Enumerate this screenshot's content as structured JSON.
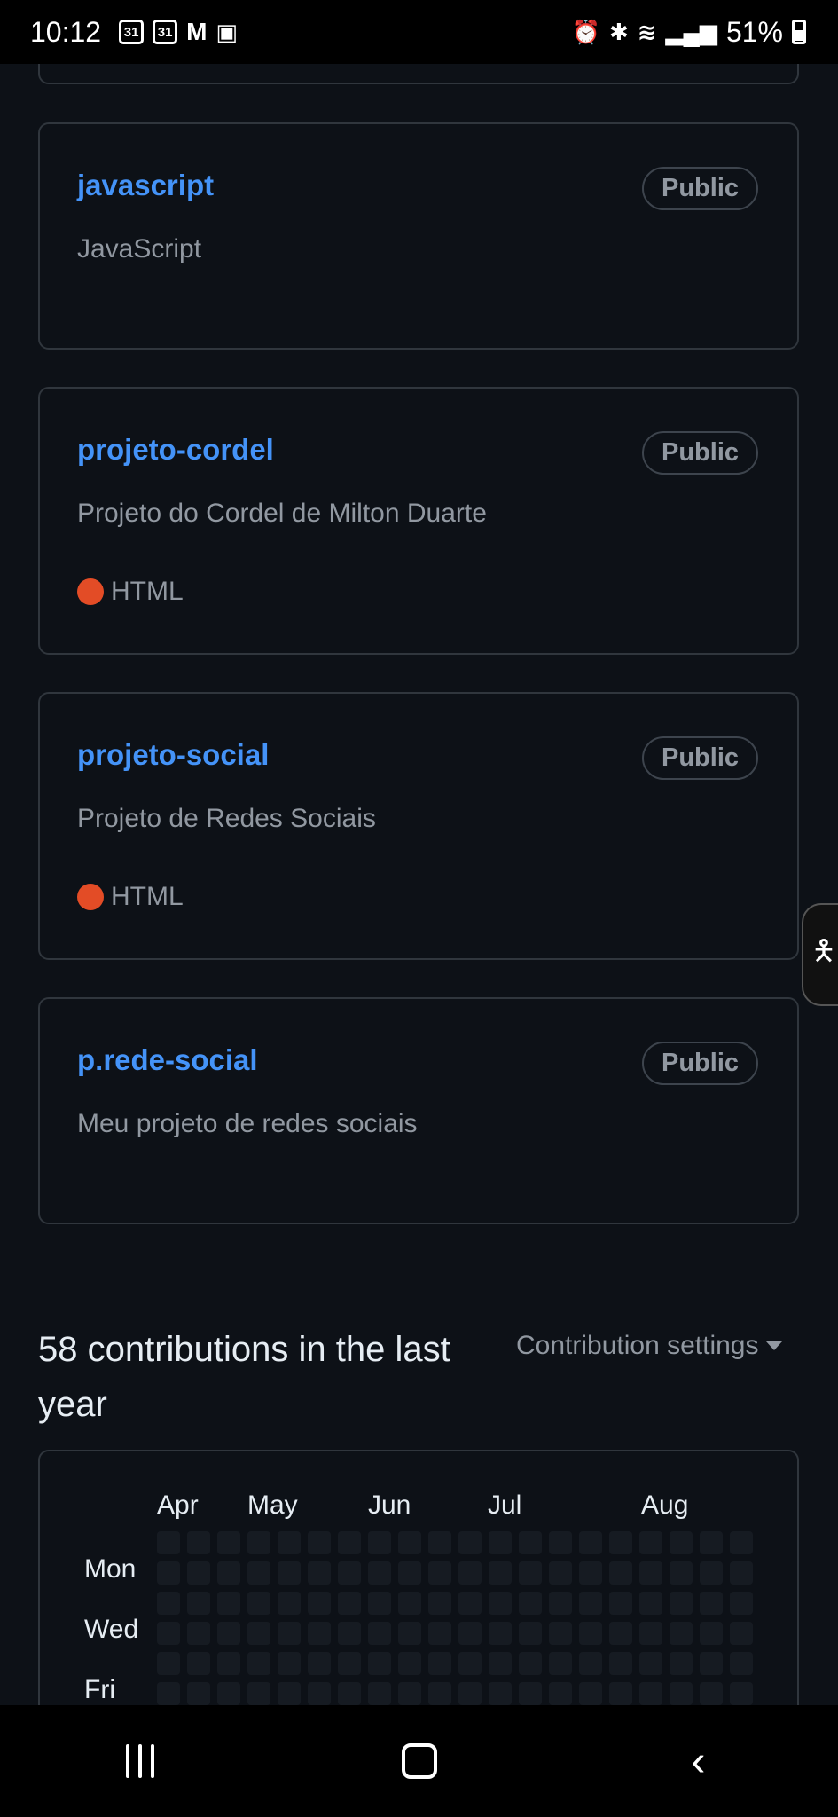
{
  "status_bar": {
    "time": "10:12",
    "calendar_1": "31",
    "calendar_2": "31",
    "battery_pct": "51%"
  },
  "repos": [
    {
      "name": "javascript",
      "visibility": "Public",
      "description": "JavaScript"
    },
    {
      "name": "projeto-cordel",
      "visibility": "Public",
      "description": "Projeto do Cordel de Milton Duarte",
      "language": "HTML",
      "language_color": "#e34c26"
    },
    {
      "name": "projeto-social",
      "visibility": "Public",
      "description": "Projeto de Redes Sociais",
      "language": "HTML",
      "language_color": "#e34c26"
    },
    {
      "name": "p.rede-social",
      "visibility": "Public",
      "description": "Meu projeto de redes sociais"
    }
  ],
  "contributions": {
    "title": "58 contributions in the last year",
    "settings_label": "Contribution settings",
    "months": [
      "Apr",
      "May",
      "Jun",
      "Jul",
      "Aug"
    ],
    "days": [
      "Mon",
      "Wed",
      "Fri"
    ]
  },
  "colors": {
    "background": "#0d1117",
    "link": "#4493f8",
    "muted": "#9198a1",
    "border": "#30363d",
    "html": "#e34c26"
  }
}
